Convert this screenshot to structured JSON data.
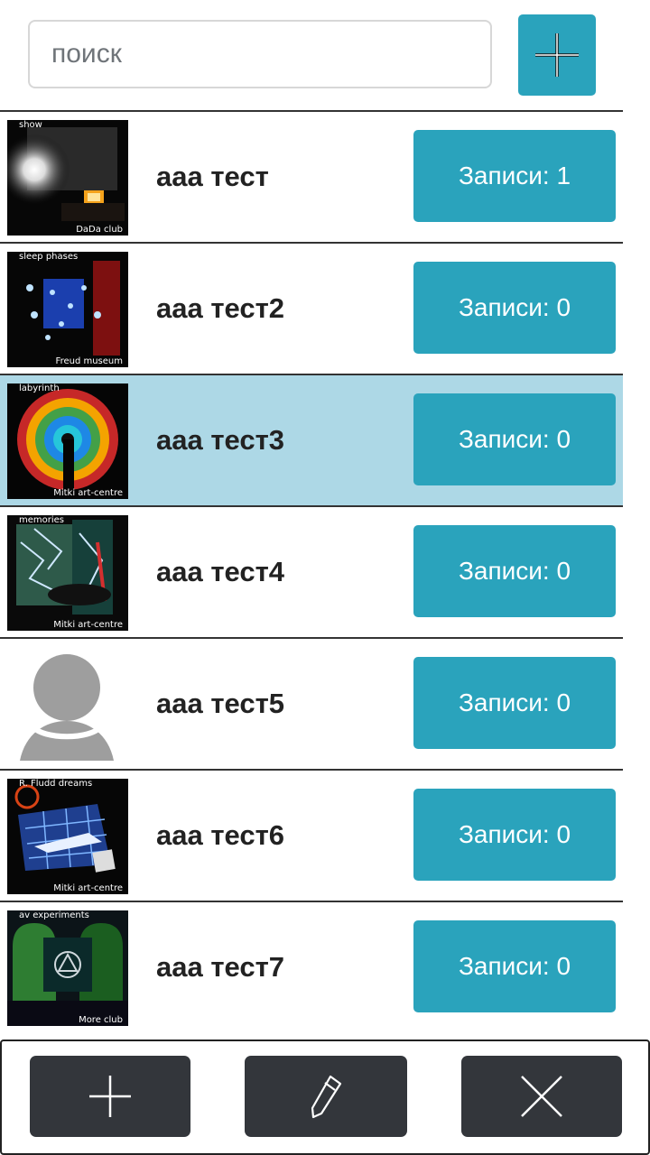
{
  "search": {
    "placeholder": "поиск",
    "value": ""
  },
  "header": {
    "add_icon": "plus-icon"
  },
  "rows": [
    {
      "title": "ааа тест",
      "count_label": "Записи: 1",
      "thumb_top": "show",
      "thumb_bottom": "DaDa club",
      "selected": false
    },
    {
      "title": "ааа тест2",
      "count_label": "Записи: 0",
      "thumb_top": "sleep phases",
      "thumb_bottom": "Freud museum",
      "selected": false
    },
    {
      "title": "ааа тест3",
      "count_label": "Записи: 0",
      "thumb_top": "labyrinth",
      "thumb_bottom": "Mitki art-centre",
      "selected": true
    },
    {
      "title": "ааа тест4",
      "count_label": "Записи: 0",
      "thumb_top": "memories",
      "thumb_bottom": "Mitki art-centre",
      "selected": false
    },
    {
      "title": "ааа тест5",
      "count_label": "Записи: 0",
      "thumb_top": "",
      "thumb_bottom": "",
      "selected": false
    },
    {
      "title": "ааа тест6",
      "count_label": "Записи: 0",
      "thumb_top": "R. Fludd dreams",
      "thumb_bottom": "Mitki art-centre",
      "selected": false
    },
    {
      "title": "ааа тест7",
      "count_label": "Записи: 0",
      "thumb_top": "av experiments",
      "thumb_bottom": "More club",
      "selected": false
    }
  ],
  "toolbar": {
    "icons": [
      "plus-icon",
      "pencil-icon",
      "close-icon"
    ]
  },
  "colors": {
    "accent": "#2aa3bc",
    "selected_row": "#add8e6",
    "toolbar_button": "#33363b"
  }
}
